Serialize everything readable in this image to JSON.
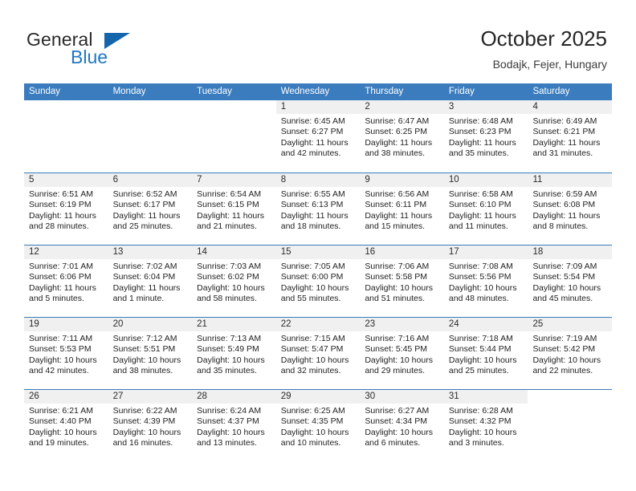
{
  "brand": {
    "name_top": "General",
    "name_bottom": "Blue",
    "icon": "triangle-logo-icon",
    "color_top": "#2a2a2a",
    "color_bottom": "#1f76c4",
    "triangle_color": "#1565ad"
  },
  "header": {
    "title": "October 2025",
    "subtitle": "Bodajk, Fejer, Hungary"
  },
  "theme": {
    "header_blue": "#3a7cbe",
    "daynum_band": "#f0f0f0",
    "text": "#222222"
  },
  "weekdays": [
    "Sunday",
    "Monday",
    "Tuesday",
    "Wednesday",
    "Thursday",
    "Friday",
    "Saturday"
  ],
  "weeks": [
    [
      {
        "day": "",
        "lines": []
      },
      {
        "day": "",
        "lines": []
      },
      {
        "day": "",
        "lines": []
      },
      {
        "day": "1",
        "lines": [
          "Sunrise: 6:45 AM",
          "Sunset: 6:27 PM",
          "Daylight: 11 hours",
          "and 42 minutes."
        ]
      },
      {
        "day": "2",
        "lines": [
          "Sunrise: 6:47 AM",
          "Sunset: 6:25 PM",
          "Daylight: 11 hours",
          "and 38 minutes."
        ]
      },
      {
        "day": "3",
        "lines": [
          "Sunrise: 6:48 AM",
          "Sunset: 6:23 PM",
          "Daylight: 11 hours",
          "and 35 minutes."
        ]
      },
      {
        "day": "4",
        "lines": [
          "Sunrise: 6:49 AM",
          "Sunset: 6:21 PM",
          "Daylight: 11 hours",
          "and 31 minutes."
        ]
      }
    ],
    [
      {
        "day": "5",
        "lines": [
          "Sunrise: 6:51 AM",
          "Sunset: 6:19 PM",
          "Daylight: 11 hours",
          "and 28 minutes."
        ]
      },
      {
        "day": "6",
        "lines": [
          "Sunrise: 6:52 AM",
          "Sunset: 6:17 PM",
          "Daylight: 11 hours",
          "and 25 minutes."
        ]
      },
      {
        "day": "7",
        "lines": [
          "Sunrise: 6:54 AM",
          "Sunset: 6:15 PM",
          "Daylight: 11 hours",
          "and 21 minutes."
        ]
      },
      {
        "day": "8",
        "lines": [
          "Sunrise: 6:55 AM",
          "Sunset: 6:13 PM",
          "Daylight: 11 hours",
          "and 18 minutes."
        ]
      },
      {
        "day": "9",
        "lines": [
          "Sunrise: 6:56 AM",
          "Sunset: 6:11 PM",
          "Daylight: 11 hours",
          "and 15 minutes."
        ]
      },
      {
        "day": "10",
        "lines": [
          "Sunrise: 6:58 AM",
          "Sunset: 6:10 PM",
          "Daylight: 11 hours",
          "and 11 minutes."
        ]
      },
      {
        "day": "11",
        "lines": [
          "Sunrise: 6:59 AM",
          "Sunset: 6:08 PM",
          "Daylight: 11 hours",
          "and 8 minutes."
        ]
      }
    ],
    [
      {
        "day": "12",
        "lines": [
          "Sunrise: 7:01 AM",
          "Sunset: 6:06 PM",
          "Daylight: 11 hours",
          "and 5 minutes."
        ]
      },
      {
        "day": "13",
        "lines": [
          "Sunrise: 7:02 AM",
          "Sunset: 6:04 PM",
          "Daylight: 11 hours",
          "and 1 minute."
        ]
      },
      {
        "day": "14",
        "lines": [
          "Sunrise: 7:03 AM",
          "Sunset: 6:02 PM",
          "Daylight: 10 hours",
          "and 58 minutes."
        ]
      },
      {
        "day": "15",
        "lines": [
          "Sunrise: 7:05 AM",
          "Sunset: 6:00 PM",
          "Daylight: 10 hours",
          "and 55 minutes."
        ]
      },
      {
        "day": "16",
        "lines": [
          "Sunrise: 7:06 AM",
          "Sunset: 5:58 PM",
          "Daylight: 10 hours",
          "and 51 minutes."
        ]
      },
      {
        "day": "17",
        "lines": [
          "Sunrise: 7:08 AM",
          "Sunset: 5:56 PM",
          "Daylight: 10 hours",
          "and 48 minutes."
        ]
      },
      {
        "day": "18",
        "lines": [
          "Sunrise: 7:09 AM",
          "Sunset: 5:54 PM",
          "Daylight: 10 hours",
          "and 45 minutes."
        ]
      }
    ],
    [
      {
        "day": "19",
        "lines": [
          "Sunrise: 7:11 AM",
          "Sunset: 5:53 PM",
          "Daylight: 10 hours",
          "and 42 minutes."
        ]
      },
      {
        "day": "20",
        "lines": [
          "Sunrise: 7:12 AM",
          "Sunset: 5:51 PM",
          "Daylight: 10 hours",
          "and 38 minutes."
        ]
      },
      {
        "day": "21",
        "lines": [
          "Sunrise: 7:13 AM",
          "Sunset: 5:49 PM",
          "Daylight: 10 hours",
          "and 35 minutes."
        ]
      },
      {
        "day": "22",
        "lines": [
          "Sunrise: 7:15 AM",
          "Sunset: 5:47 PM",
          "Daylight: 10 hours",
          "and 32 minutes."
        ]
      },
      {
        "day": "23",
        "lines": [
          "Sunrise: 7:16 AM",
          "Sunset: 5:45 PM",
          "Daylight: 10 hours",
          "and 29 minutes."
        ]
      },
      {
        "day": "24",
        "lines": [
          "Sunrise: 7:18 AM",
          "Sunset: 5:44 PM",
          "Daylight: 10 hours",
          "and 25 minutes."
        ]
      },
      {
        "day": "25",
        "lines": [
          "Sunrise: 7:19 AM",
          "Sunset: 5:42 PM",
          "Daylight: 10 hours",
          "and 22 minutes."
        ]
      }
    ],
    [
      {
        "day": "26",
        "lines": [
          "Sunrise: 6:21 AM",
          "Sunset: 4:40 PM",
          "Daylight: 10 hours",
          "and 19 minutes."
        ]
      },
      {
        "day": "27",
        "lines": [
          "Sunrise: 6:22 AM",
          "Sunset: 4:39 PM",
          "Daylight: 10 hours",
          "and 16 minutes."
        ]
      },
      {
        "day": "28",
        "lines": [
          "Sunrise: 6:24 AM",
          "Sunset: 4:37 PM",
          "Daylight: 10 hours",
          "and 13 minutes."
        ]
      },
      {
        "day": "29",
        "lines": [
          "Sunrise: 6:25 AM",
          "Sunset: 4:35 PM",
          "Daylight: 10 hours",
          "and 10 minutes."
        ]
      },
      {
        "day": "30",
        "lines": [
          "Sunrise: 6:27 AM",
          "Sunset: 4:34 PM",
          "Daylight: 10 hours",
          "and 6 minutes."
        ]
      },
      {
        "day": "31",
        "lines": [
          "Sunrise: 6:28 AM",
          "Sunset: 4:32 PM",
          "Daylight: 10 hours",
          "and 3 minutes."
        ]
      },
      {
        "day": "",
        "lines": []
      }
    ]
  ]
}
